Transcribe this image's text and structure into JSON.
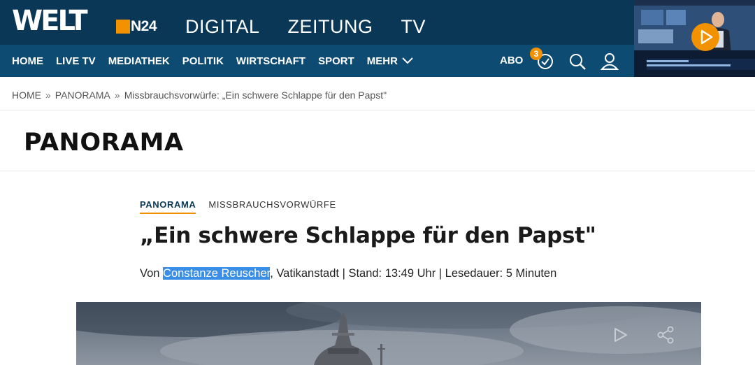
{
  "header": {
    "logo": "WELT",
    "n24": "N24",
    "top_links": [
      "DIGITAL",
      "ZEITUNG",
      "TV"
    ],
    "nav": [
      "HOME",
      "LIVE TV",
      "MEDIATHEK",
      "POLITIK",
      "WIRTSCHAFT",
      "SPORT",
      "MEHR"
    ],
    "abo": "ABO",
    "watchlist_count": "3"
  },
  "breadcrumb": [
    "HOME",
    "PANORAMA",
    "Missbrauchsvorwürfe: „Ein schwere Schlappe für den Papst\""
  ],
  "section_title": "PANORAMA",
  "article": {
    "kicker": "PANORAMA",
    "topic": "MISSBRAUCHSVORWÜRFE",
    "headline": "„Ein schwere Schlappe für den Papst\"",
    "byline_prefix": "Von ",
    "author": "Constanze Reuscher",
    "byline_rest": ", Vatikanstadt | Stand: 13:49 Uhr | Lesedauer: 5 Minuten"
  },
  "colors": {
    "brand_dark": "#0a3756",
    "brand_nav": "#0e4b73",
    "accent": "#f39200"
  }
}
